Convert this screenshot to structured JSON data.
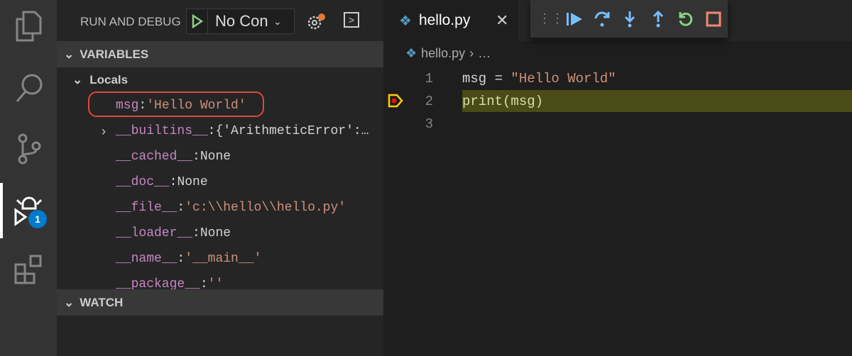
{
  "activity_bar": {
    "items": [
      "explorer-icon",
      "search-icon",
      "source-control-icon",
      "run-debug-icon",
      "extensions-icon"
    ],
    "debug_badge": "1"
  },
  "sidebar": {
    "title": "RUN AND DEBUG",
    "config": "No Con",
    "variables_label": "VARIABLES",
    "locals_label": "Locals",
    "watch_label": "WATCH",
    "variables": [
      {
        "key": "msg",
        "value": "'Hello World'",
        "type": "string",
        "expandable": false
      },
      {
        "key": "__builtins__",
        "value": "{'ArithmeticError':…",
        "type": "plain",
        "expandable": true
      },
      {
        "key": "__cached__",
        "value": "None",
        "type": "plain",
        "expandable": false
      },
      {
        "key": "__doc__",
        "value": "None",
        "type": "plain",
        "expandable": false
      },
      {
        "key": "__file__",
        "value": "'c:\\\\hello\\\\hello.py'",
        "type": "string",
        "expandable": false
      },
      {
        "key": "__loader__",
        "value": "None",
        "type": "plain",
        "expandable": false
      },
      {
        "key": "__name__",
        "value": "'__main__'",
        "type": "string",
        "expandable": false
      },
      {
        "key": "__package__",
        "value": "''",
        "type": "string",
        "expandable": false
      }
    ]
  },
  "editor": {
    "tab": "hello.py",
    "breadcrumb_file": "hello.py",
    "breadcrumb_more": "…",
    "current_line": 2,
    "lines": [
      {
        "num": "1",
        "tokens": [
          {
            "t": "msg = ",
            "c": "#d4d4d4"
          },
          {
            "t": "\"Hello World\"",
            "c": "#ce9178"
          }
        ]
      },
      {
        "num": "2",
        "tokens": [
          {
            "t": "print(msg)",
            "c": "#dcdcaa"
          }
        ]
      },
      {
        "num": "3",
        "tokens": []
      }
    ]
  },
  "debug_toolbar": [
    "continue-icon",
    "step-over-icon",
    "step-into-icon",
    "step-out-icon",
    "restart-icon",
    "stop-icon"
  ],
  "colors": {
    "accent": "#75beff",
    "restart": "#89d185",
    "stop": "#f48771",
    "highlight_border": "#e0463a"
  }
}
